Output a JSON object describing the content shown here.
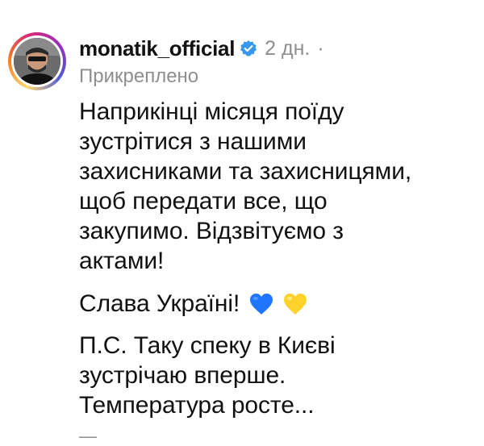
{
  "comment": {
    "username": "monatik_official",
    "verified_icon": "verified-badge-icon",
    "verified_color": "#3897f0",
    "time": "2 дн.",
    "separator": "·",
    "pinned_label": "Прикреплено",
    "text": {
      "paragraph1_lines": [
        "Наприкінці місяця поїду",
        "зустрітися з нашими",
        "захисниками та захисницями,",
        "щоб передати все, що",
        "закупимо. Відзвітуємо з",
        "актами!"
      ],
      "paragraph2": "Слава Україні!",
      "paragraph2_emoji": [
        "blue-heart-icon",
        "yellow-heart-icon"
      ],
      "paragraph3_lines": [
        "П.С. Таку спеку в Києві",
        "зустрічаю вперше.",
        "Температура росте..."
      ],
      "more_indicator": "—"
    },
    "colors": {
      "text": "#111111",
      "meta": "#8e8e8e",
      "blue_heart": "#1f75fe",
      "yellow_heart": "#ffd12b"
    }
  }
}
